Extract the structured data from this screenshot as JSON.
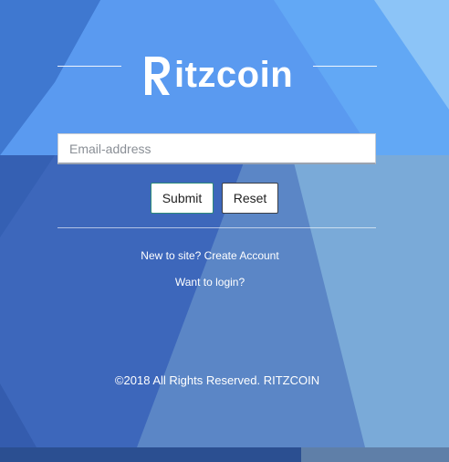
{
  "brand": {
    "logo_text": "itzcoin",
    "logo_letter": "R"
  },
  "form": {
    "email_placeholder": "Email-address",
    "email_value": "",
    "submit_label": "Submit",
    "reset_label": "Reset"
  },
  "links": {
    "create_account": "New to site? Create Account",
    "login": "Want to login?"
  },
  "footer": {
    "copyright": "©2018 All Rights Reserved. RITZCOIN"
  },
  "colors": {
    "bg_dark": "#3a66bd",
    "bg_light": "#7fb6f0",
    "accent_green": "#2e8b7a"
  }
}
